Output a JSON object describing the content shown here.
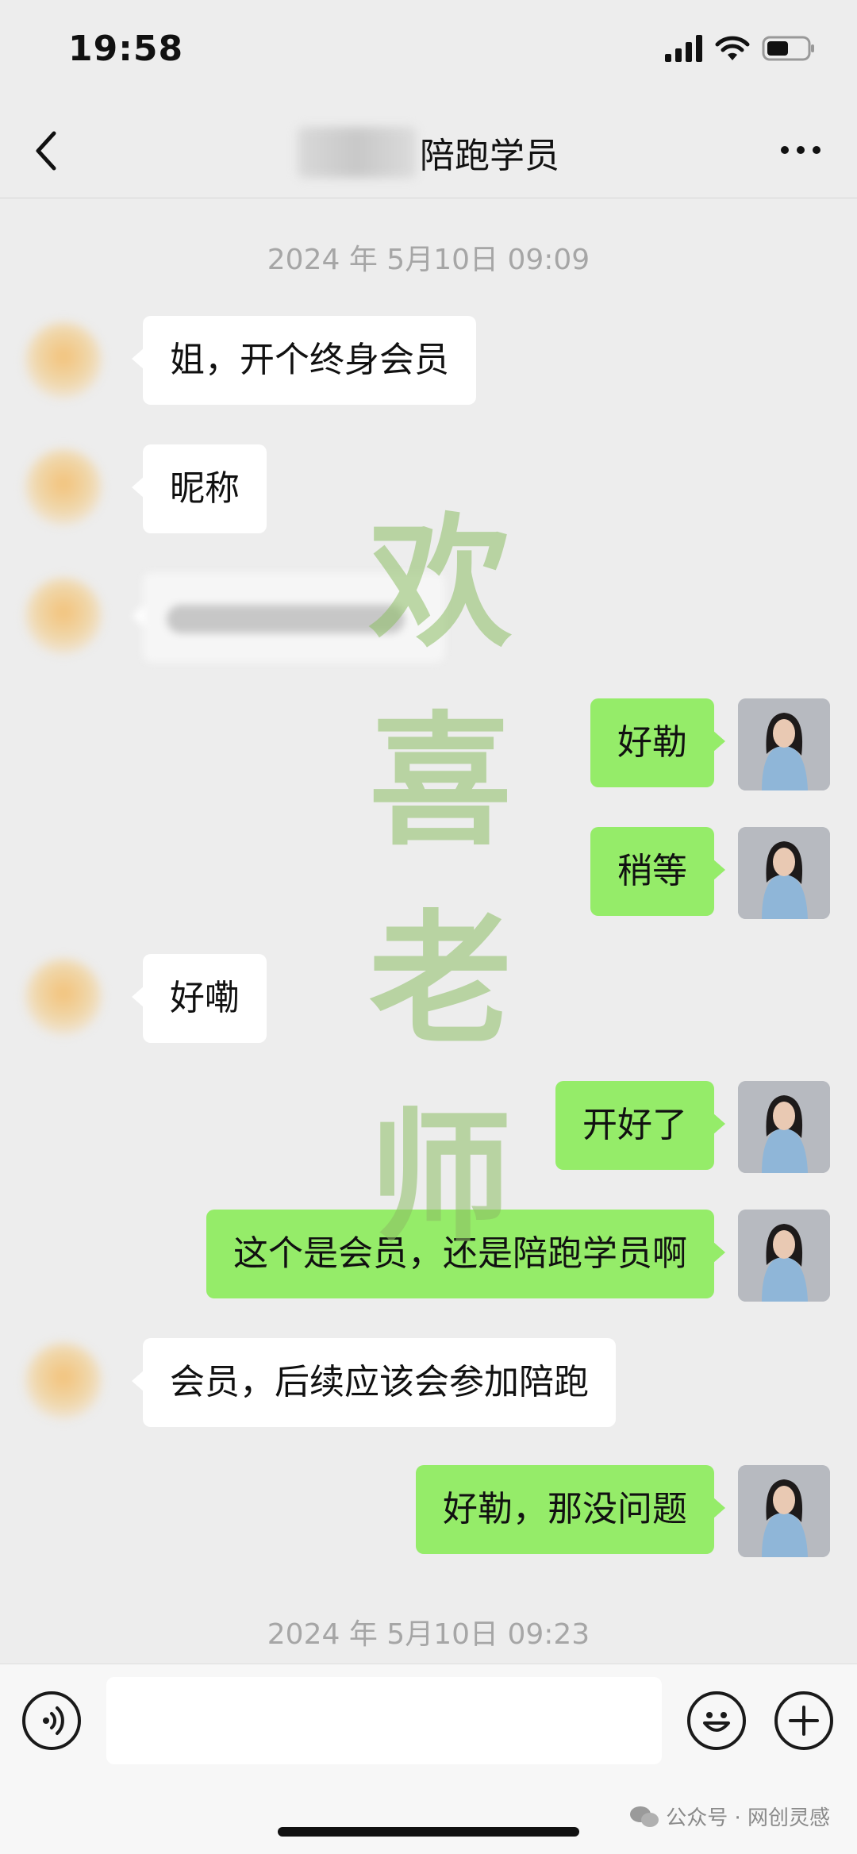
{
  "status_bar": {
    "time": "19:58"
  },
  "nav": {
    "title": "陪跑学员"
  },
  "watermark": {
    "chars": [
      "欢",
      "喜",
      "老",
      "师"
    ]
  },
  "timestamps": [
    "2024 年 5月10日 09:09",
    "2024 年 5月10日 09:23"
  ],
  "messages": [
    {
      "side": "left",
      "text": "姐，开个终身会员"
    },
    {
      "side": "left",
      "text": "昵称"
    },
    {
      "side": "left",
      "text": ""
    },
    {
      "side": "right",
      "text": "好勒"
    },
    {
      "side": "right",
      "text": "稍等"
    },
    {
      "side": "left",
      "text": "好嘞"
    },
    {
      "side": "right",
      "text": "开好了"
    },
    {
      "side": "right",
      "text": "这个是会员，还是陪跑学员啊"
    },
    {
      "side": "left",
      "text": "会员，后续应该会参加陪跑"
    },
    {
      "side": "right",
      "text": "好勒，那没问题"
    }
  ],
  "footer": {
    "credit": "公众号 · 网创灵感"
  },
  "colors": {
    "background": "#ededed",
    "sent_bubble": "#95ec69",
    "received_bubble": "#ffffff"
  }
}
